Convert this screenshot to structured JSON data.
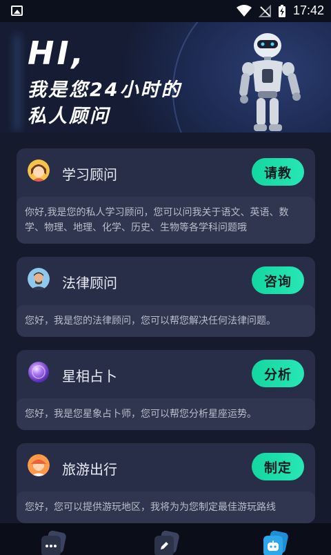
{
  "status_bar": {
    "time": "17:42",
    "icons": [
      "image-icon",
      "wifi-icon",
      "signal-off-icon",
      "battery-charging-icon"
    ]
  },
  "hero": {
    "greeting": "HI,",
    "line1": "我是您24小时的",
    "line2": "私人顾问",
    "image": "robot-illustration"
  },
  "advisors": [
    {
      "icon": "student-avatar-icon",
      "title": "学习顾问",
      "action": "请教",
      "description": "你好,我是您的私人学习顾问，您可以问我关于语文、英语、数学、物理、地理、化学、历史、生物等各学科问题哦"
    },
    {
      "icon": "lawyer-avatar-icon",
      "title": "法律顾问",
      "action": "咨询",
      "description": "您好，我是您的法律顾问，您可以帮您解决任何法律问题。"
    },
    {
      "icon": "astrology-orb-icon",
      "title": "星相占卜",
      "action": "分析",
      "description": "您好，我是您星象占卜师，您可以帮您分析星座运势。"
    },
    {
      "icon": "traveler-avatar-icon",
      "title": "旅游出行",
      "action": "制定",
      "description": "您好，您可以提供游玩地区，我将为为您制定最佳游玩路线"
    }
  ],
  "bottom_nav": {
    "items": [
      {
        "icon": "chat-bubble-icon",
        "active": false
      },
      {
        "icon": "edit-pen-icon",
        "active": false
      },
      {
        "icon": "robot-face-icon",
        "active": true
      }
    ]
  },
  "colors": {
    "background": "#151a2c",
    "card": "#282e48",
    "accent": "#14d6a0"
  }
}
